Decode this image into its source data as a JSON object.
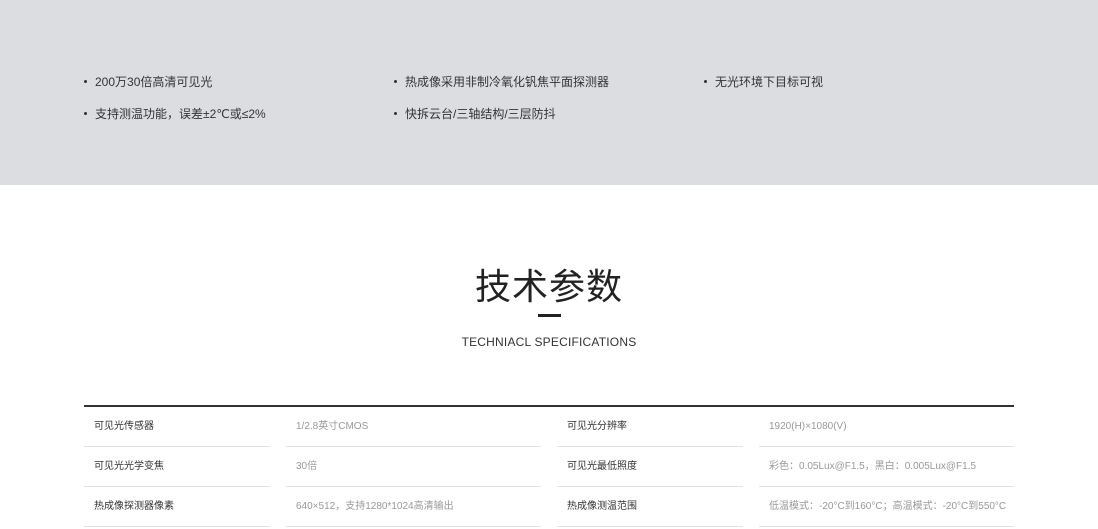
{
  "features": {
    "items": [
      "200万30倍高清可见光",
      "热成像采用非制冷氧化钒焦平面探测器",
      "无光环境下目标可视",
      "支持测温功能，误差±2℃或≤2%",
      "快拆云台/三轴结构/三层防抖"
    ]
  },
  "specs": {
    "title": "技术参数",
    "subtitle": "TECHNIACL SPECIFICATIONS",
    "rows": [
      {
        "label1": "可见光传感器",
        "value1": "1/2.8英寸CMOS",
        "label2": "可见光分辨率",
        "value2": "1920(H)×1080(V)"
      },
      {
        "label1": "可见光光学变焦",
        "value1": "30倍",
        "label2": "可见光最低照度",
        "value2": "彩色：0.05Lux@F1.5，黑白：0.005Lux@F1.5"
      },
      {
        "label1": "热成像探测器像素",
        "value1": "640×512，支持1280*1024高清输出",
        "label2": "热成像测温范围",
        "value2": "低温模式：-20°C到160°C；高温模式：-20°C到550°C"
      }
    ]
  }
}
